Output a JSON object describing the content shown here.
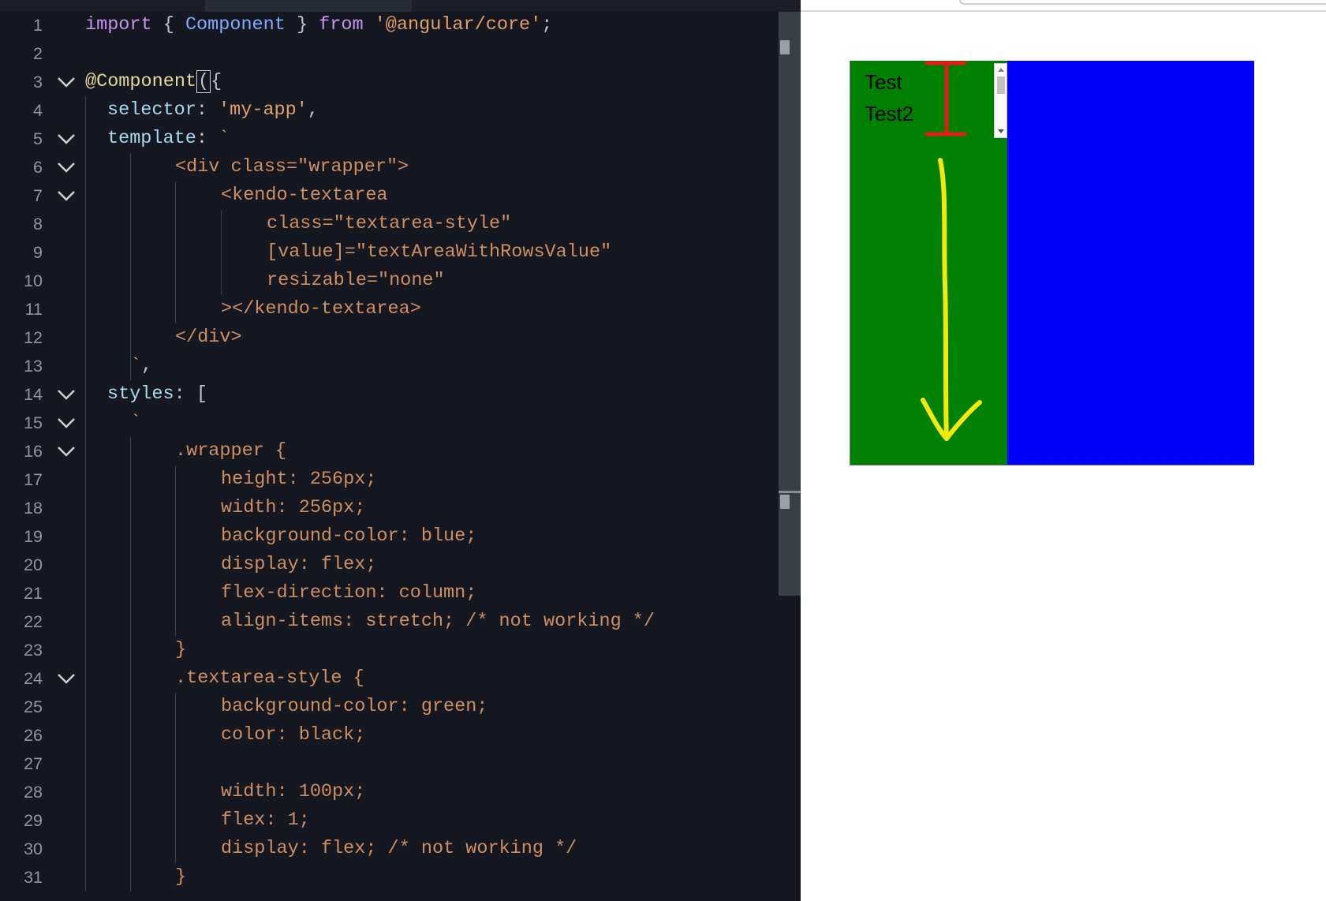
{
  "editor": {
    "lines": [
      {
        "num": "1",
        "fold": false,
        "tokens": [
          {
            "t": "import",
            "c": "k-import"
          },
          {
            "t": " { ",
            "c": "k-punc"
          },
          {
            "t": "Component",
            "c": "k-ident"
          },
          {
            "t": " } ",
            "c": "k-punc"
          },
          {
            "t": "from",
            "c": "k-import"
          },
          {
            "t": " ",
            "c": "k-punc"
          },
          {
            "t": "'@angular/core'",
            "c": "k-str"
          },
          {
            "t": ";",
            "c": "k-punc"
          }
        ]
      },
      {
        "num": "2",
        "fold": false,
        "tokens": []
      },
      {
        "num": "3",
        "fold": true,
        "tokens": [
          {
            "t": "@Component",
            "c": "k-deco"
          },
          {
            "t": "(",
            "c": "k-punc cursor-box"
          },
          {
            "t": "{",
            "c": "k-punc"
          }
        ]
      },
      {
        "num": "4",
        "fold": false,
        "tokens": [
          {
            "t": "selector",
            "c": "k-prop"
          },
          {
            "t": ": ",
            "c": "k-punc"
          },
          {
            "t": "'my-app'",
            "c": "k-str"
          },
          {
            "t": ",",
            "c": "k-punc"
          }
        ]
      },
      {
        "num": "5",
        "fold": true,
        "tokens": [
          {
            "t": "template",
            "c": "k-prop"
          },
          {
            "t": ": ",
            "c": "k-punc"
          },
          {
            "t": "`",
            "c": "k-str"
          }
        ]
      },
      {
        "num": "6",
        "fold": true,
        "tokens": [
          {
            "t": "<div class=\"wrapper\">",
            "c": "k-code"
          }
        ]
      },
      {
        "num": "7",
        "fold": true,
        "tokens": [
          {
            "t": "<kendo-textarea",
            "c": "k-code"
          }
        ]
      },
      {
        "num": "8",
        "fold": false,
        "tokens": [
          {
            "t": "class=\"textarea-style\"",
            "c": "k-code"
          }
        ]
      },
      {
        "num": "9",
        "fold": false,
        "tokens": [
          {
            "t": "[value]=\"textAreaWithRowsValue\"",
            "c": "k-code"
          }
        ]
      },
      {
        "num": "10",
        "fold": false,
        "tokens": [
          {
            "t": "resizable=\"none\"",
            "c": "k-code"
          }
        ]
      },
      {
        "num": "11",
        "fold": false,
        "tokens": [
          {
            "t": "></kendo-textarea>",
            "c": "k-code"
          }
        ]
      },
      {
        "num": "12",
        "fold": false,
        "tokens": [
          {
            "t": "</div>",
            "c": "k-code"
          }
        ]
      },
      {
        "num": "13",
        "fold": false,
        "tokens": [
          {
            "t": "`",
            "c": "k-str"
          },
          {
            "t": ",",
            "c": "k-punc"
          }
        ]
      },
      {
        "num": "14",
        "fold": true,
        "tokens": [
          {
            "t": "styles",
            "c": "k-prop"
          },
          {
            "t": ": [",
            "c": "k-punc"
          }
        ]
      },
      {
        "num": "15",
        "fold": true,
        "tokens": [
          {
            "t": "`",
            "c": "k-str"
          }
        ]
      },
      {
        "num": "16",
        "fold": true,
        "tokens": [
          {
            "t": ".wrapper {",
            "c": "k-code"
          }
        ]
      },
      {
        "num": "17",
        "fold": false,
        "tokens": [
          {
            "t": "height: 256px;",
            "c": "k-code"
          }
        ]
      },
      {
        "num": "18",
        "fold": false,
        "tokens": [
          {
            "t": "width: 256px;",
            "c": "k-code"
          }
        ]
      },
      {
        "num": "19",
        "fold": false,
        "tokens": [
          {
            "t": "background-color: blue;",
            "c": "k-code"
          }
        ]
      },
      {
        "num": "20",
        "fold": false,
        "tokens": [
          {
            "t": "display: flex;",
            "c": "k-code"
          }
        ]
      },
      {
        "num": "21",
        "fold": false,
        "tokens": [
          {
            "t": "flex-direction: column;",
            "c": "k-code"
          }
        ]
      },
      {
        "num": "22",
        "fold": false,
        "tokens": [
          {
            "t": "align-items: stretch; /* not working */",
            "c": "k-code"
          }
        ]
      },
      {
        "num": "23",
        "fold": false,
        "tokens": [
          {
            "t": "}",
            "c": "k-code"
          }
        ]
      },
      {
        "num": "24",
        "fold": true,
        "tokens": [
          {
            "t": ".textarea-style {",
            "c": "k-code"
          }
        ]
      },
      {
        "num": "25",
        "fold": false,
        "tokens": [
          {
            "t": "background-color: green;",
            "c": "k-code"
          }
        ]
      },
      {
        "num": "26",
        "fold": false,
        "tokens": [
          {
            "t": "color: black;",
            "c": "k-code"
          }
        ]
      },
      {
        "num": "27",
        "fold": false,
        "tokens": []
      },
      {
        "num": "28",
        "fold": false,
        "tokens": [
          {
            "t": "width: 100px;",
            "c": "k-code"
          }
        ]
      },
      {
        "num": "29",
        "fold": false,
        "tokens": [
          {
            "t": "flex: 1;",
            "c": "k-code"
          }
        ]
      },
      {
        "num": "30",
        "fold": false,
        "tokens": [
          {
            "t": "display: flex; /* not working */",
            "c": "k-code"
          }
        ]
      },
      {
        "num": "31",
        "fold": false,
        "tokens": [
          {
            "t": "}",
            "c": "k-code"
          }
        ]
      }
    ]
  },
  "preview": {
    "textarea_lines": [
      "Test",
      "Test2"
    ],
    "colors": {
      "wrapper": "#0000ff",
      "textarea": "#008000",
      "annotation_bracket": "#e31b1b",
      "annotation_arrow": "#f5e90c"
    }
  }
}
